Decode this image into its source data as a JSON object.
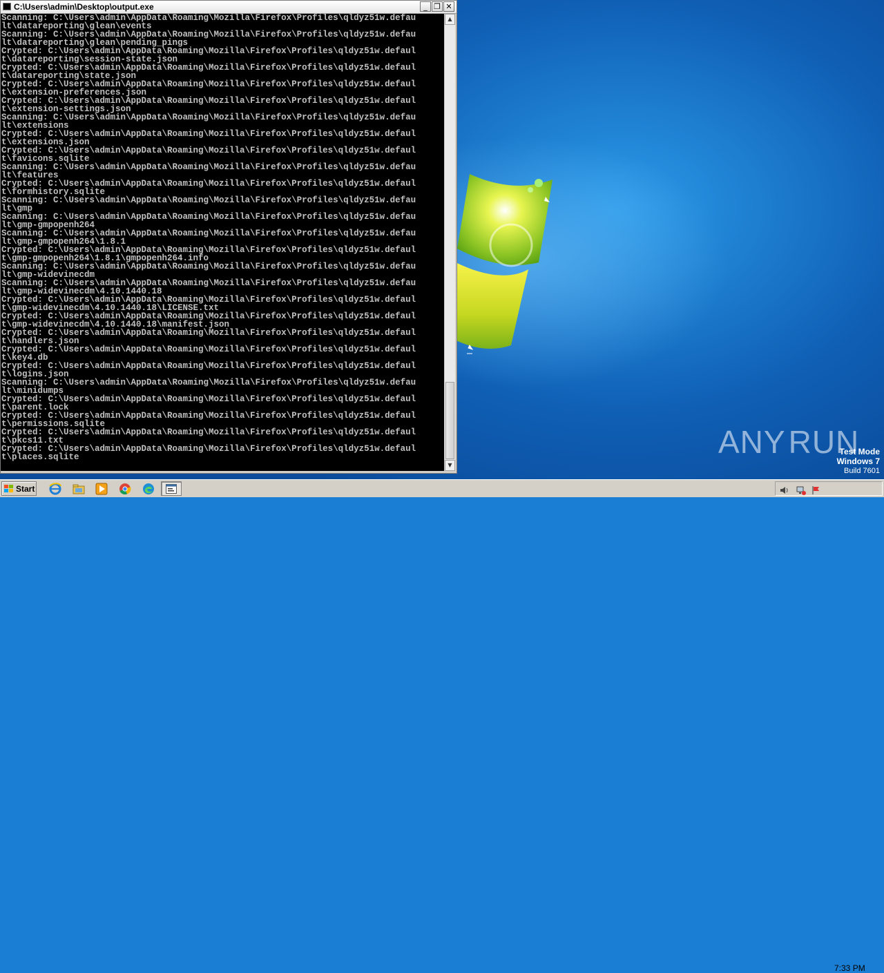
{
  "window": {
    "title": "C:\\Users\\admin\\Desktop\\output.exe",
    "minimize_label": "_",
    "maximize_label": "❐",
    "close_label": "✕"
  },
  "console": {
    "lines": [
      "Scanning: C:\\Users\\admin\\AppData\\Roaming\\Mozilla\\Firefox\\Profiles\\qldyz51w.defau",
      "lt\\datareporting\\glean\\events",
      "Scanning: C:\\Users\\admin\\AppData\\Roaming\\Mozilla\\Firefox\\Profiles\\qldyz51w.defau",
      "lt\\datareporting\\glean\\pending_pings",
      "Crypted: C:\\Users\\admin\\AppData\\Roaming\\Mozilla\\Firefox\\Profiles\\qldyz51w.defaul",
      "t\\datareporting\\session-state.json",
      "Crypted: C:\\Users\\admin\\AppData\\Roaming\\Mozilla\\Firefox\\Profiles\\qldyz51w.defaul",
      "t\\datareporting\\state.json",
      "Crypted: C:\\Users\\admin\\AppData\\Roaming\\Mozilla\\Firefox\\Profiles\\qldyz51w.defaul",
      "t\\extension-preferences.json",
      "Crypted: C:\\Users\\admin\\AppData\\Roaming\\Mozilla\\Firefox\\Profiles\\qldyz51w.defaul",
      "t\\extension-settings.json",
      "Scanning: C:\\Users\\admin\\AppData\\Roaming\\Mozilla\\Firefox\\Profiles\\qldyz51w.defau",
      "lt\\extensions",
      "Crypted: C:\\Users\\admin\\AppData\\Roaming\\Mozilla\\Firefox\\Profiles\\qldyz51w.defaul",
      "t\\extensions.json",
      "Crypted: C:\\Users\\admin\\AppData\\Roaming\\Mozilla\\Firefox\\Profiles\\qldyz51w.defaul",
      "t\\favicons.sqlite",
      "Scanning: C:\\Users\\admin\\AppData\\Roaming\\Mozilla\\Firefox\\Profiles\\qldyz51w.defau",
      "lt\\features",
      "Crypted: C:\\Users\\admin\\AppData\\Roaming\\Mozilla\\Firefox\\Profiles\\qldyz51w.defaul",
      "t\\formhistory.sqlite",
      "Scanning: C:\\Users\\admin\\AppData\\Roaming\\Mozilla\\Firefox\\Profiles\\qldyz51w.defau",
      "lt\\gmp",
      "Scanning: C:\\Users\\admin\\AppData\\Roaming\\Mozilla\\Firefox\\Profiles\\qldyz51w.defau",
      "lt\\gmp-gmpopenh264",
      "Scanning: C:\\Users\\admin\\AppData\\Roaming\\Mozilla\\Firefox\\Profiles\\qldyz51w.defau",
      "lt\\gmp-gmpopenh264\\1.8.1",
      "Crypted: C:\\Users\\admin\\AppData\\Roaming\\Mozilla\\Firefox\\Profiles\\qldyz51w.defaul",
      "t\\gmp-gmpopenh264\\1.8.1\\gmpopenh264.info",
      "Scanning: C:\\Users\\admin\\AppData\\Roaming\\Mozilla\\Firefox\\Profiles\\qldyz51w.defau",
      "lt\\gmp-widevinecdm",
      "Scanning: C:\\Users\\admin\\AppData\\Roaming\\Mozilla\\Firefox\\Profiles\\qldyz51w.defau",
      "lt\\gmp-widevinecdm\\4.10.1440.18",
      "Crypted: C:\\Users\\admin\\AppData\\Roaming\\Mozilla\\Firefox\\Profiles\\qldyz51w.defaul",
      "t\\gmp-widevinecdm\\4.10.1440.18\\LICENSE.txt",
      "Crypted: C:\\Users\\admin\\AppData\\Roaming\\Mozilla\\Firefox\\Profiles\\qldyz51w.defaul",
      "t\\gmp-widevinecdm\\4.10.1440.18\\manifest.json",
      "Crypted: C:\\Users\\admin\\AppData\\Roaming\\Mozilla\\Firefox\\Profiles\\qldyz51w.defaul",
      "t\\handlers.json",
      "Crypted: C:\\Users\\admin\\AppData\\Roaming\\Mozilla\\Firefox\\Profiles\\qldyz51w.defaul",
      "t\\key4.db",
      "Crypted: C:\\Users\\admin\\AppData\\Roaming\\Mozilla\\Firefox\\Profiles\\qldyz51w.defaul",
      "t\\logins.json",
      "Scanning: C:\\Users\\admin\\AppData\\Roaming\\Mozilla\\Firefox\\Profiles\\qldyz51w.defau",
      "lt\\minidumps",
      "Crypted: C:\\Users\\admin\\AppData\\Roaming\\Mozilla\\Firefox\\Profiles\\qldyz51w.defaul",
      "t\\parent.lock",
      "Crypted: C:\\Users\\admin\\AppData\\Roaming\\Mozilla\\Firefox\\Profiles\\qldyz51w.defaul",
      "t\\permissions.sqlite",
      "Crypted: C:\\Users\\admin\\AppData\\Roaming\\Mozilla\\Firefox\\Profiles\\qldyz51w.defaul",
      "t\\pkcs11.txt",
      "Crypted: C:\\Users\\admin\\AppData\\Roaming\\Mozilla\\Firefox\\Profiles\\qldyz51w.defaul",
      "t\\places.sqlite"
    ],
    "scrollbar_up": "▲",
    "scrollbar_down": "▼"
  },
  "watermark": {
    "brand_left": "ANY",
    "brand_right": "RUN",
    "test_mode": "Test Mode",
    "os_name": "Windows 7",
    "build": "Build 7601"
  },
  "taskbar": {
    "start_label": "Start",
    "pinned_icons": [
      "ie-icon",
      "explorer-folder-icon",
      "media-player-icon",
      "chrome-icon",
      "edge-icon",
      "console-app-icon"
    ],
    "clock": "7:33 PM",
    "tray_icons": [
      "speaker-icon",
      "network-icon",
      "flag-icon"
    ]
  }
}
